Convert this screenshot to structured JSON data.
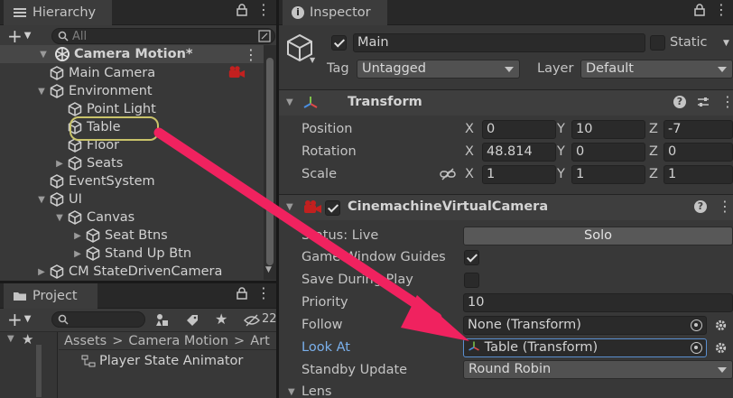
{
  "colors": {
    "accent_blue": "#7ab0ec",
    "arrow": "#f0225f",
    "highlight_outline": "#c9c36a",
    "cinemachine_red": "#c3201f"
  },
  "hierarchy": {
    "tab_label": "Hierarchy",
    "search_placeholder": "All",
    "scene_name": "Camera Motion*",
    "items": [
      {
        "label": "Main Camera",
        "fold": "",
        "icon": "cube-icon",
        "badge": "cinemachine-brain-icon"
      },
      {
        "label": "Environment",
        "fold": "▼",
        "icon": "cube-icon"
      },
      {
        "label": "Point Light",
        "fold": "",
        "icon": "cube-icon"
      },
      {
        "label": "Table",
        "fold": "",
        "icon": "cube-icon",
        "highlighted": true
      },
      {
        "label": "Floor",
        "fold": "",
        "icon": "cube-icon"
      },
      {
        "label": "Seats",
        "fold": "▶",
        "icon": "cube-icon"
      },
      {
        "label": "EventSystem",
        "fold": "",
        "icon": "cube-icon"
      },
      {
        "label": "UI",
        "fold": "▼",
        "icon": "cube-icon"
      },
      {
        "label": "Canvas",
        "fold": "▼",
        "icon": "cube-icon"
      },
      {
        "label": "Seat Btns",
        "fold": "▶",
        "icon": "cube-icon"
      },
      {
        "label": "Stand Up Btn",
        "fold": "▶",
        "icon": "cube-icon"
      },
      {
        "label": "CM StateDrivenCamera",
        "fold": "▶",
        "icon": "cube-icon"
      }
    ]
  },
  "project": {
    "tab_label": "Project",
    "badge_count": "22",
    "breadcrumb": [
      "Assets",
      "Camera Motion",
      "Art"
    ],
    "asset": "Player State Animator"
  },
  "inspector": {
    "tab_label": "Inspector",
    "object_name": "Main",
    "static_label": "Static",
    "tag_label": "Tag",
    "tag_value": "Untagged",
    "layer_label": "Layer",
    "layer_value": "Default",
    "transform": {
      "title": "Transform",
      "position_label": "Position",
      "rotation_label": "Rotation",
      "scale_label": "Scale",
      "position": {
        "x": "0",
        "y": "10",
        "z": "-7"
      },
      "rotation": {
        "x": "48.814",
        "y": "0",
        "z": "0"
      },
      "scale": {
        "x": "1",
        "y": "1",
        "z": "1"
      }
    },
    "vcam": {
      "title": "CinemachineVirtualCamera",
      "status_label": "Status: Live",
      "solo_label": "Solo",
      "game_window_guides_label": "Game Window Guides",
      "game_window_guides": true,
      "save_during_play_label": "Save During Play",
      "save_during_play": false,
      "priority_label": "Priority",
      "priority_value": "10",
      "follow_label": "Follow",
      "follow_value": "None (Transform)",
      "look_at_label": "Look At",
      "look_at_value": "Table (Transform)",
      "standby_label": "Standby Update",
      "standby_value": "Round Robin",
      "lens_label": "Lens"
    }
  }
}
